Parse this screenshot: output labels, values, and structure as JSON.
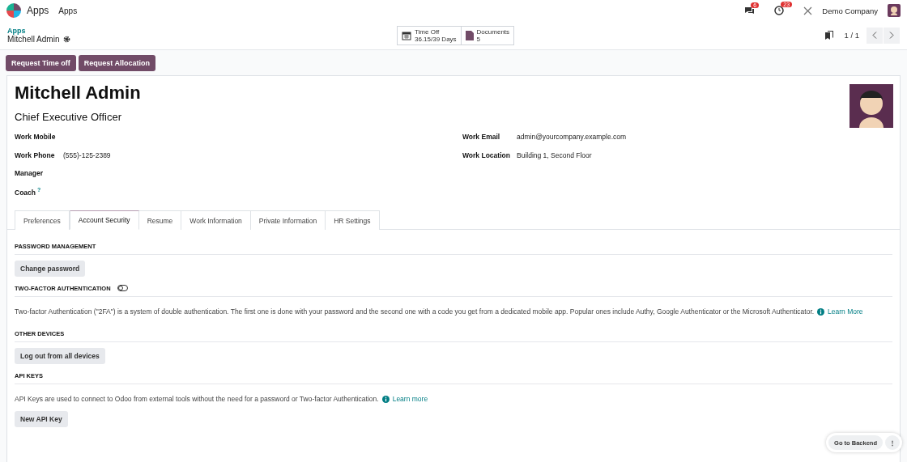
{
  "navbar": {
    "brand": "Apps",
    "menu": [
      "Apps"
    ],
    "messages_count": "6",
    "activities_count": "23",
    "company": "Demo Company"
  },
  "control_panel": {
    "breadcrumb": "Apps",
    "record": "Mitchell Admin",
    "stats": [
      {
        "kind": "calendar",
        "label": "Time Off",
        "value": "36.15/39 Days"
      },
      {
        "kind": "document",
        "label": "Documents",
        "value": "5"
      }
    ],
    "pager": "1 / 1"
  },
  "actions": [
    "Request Time off",
    "Request Allocation"
  ],
  "employee": {
    "name": "Mitchell Admin",
    "job_title": "Chief Executive Officer",
    "left_fields": [
      {
        "label": "Work Mobile"
      },
      {
        "label": "Work Phone",
        "value": "(555)-125-2389"
      },
      {
        "label": "Manager"
      },
      {
        "label": "Coach",
        "help": "?"
      }
    ],
    "right_fields": [
      {
        "label": "Work Email",
        "value": "admin@yourcompany.example.com"
      },
      {
        "label": "Work Location",
        "value": "Building 1, Second Floor"
      }
    ]
  },
  "tabs": [
    {
      "label": "Preferences",
      "selected": false
    },
    {
      "label": "Account Security",
      "selected": true
    },
    {
      "label": "Resume",
      "selected": false
    },
    {
      "label": "Work Information",
      "selected": false
    },
    {
      "label": "Private Information",
      "selected": false
    },
    {
      "label": "HR Settings",
      "selected": false
    }
  ],
  "sections": [
    {
      "title": "PASSWORD MANAGEMENT",
      "button": "Change password"
    },
    {
      "title": "TWO-FACTOR AUTHENTICATION",
      "toggle": {
        "on": false
      },
      "text": "Two-factor Authentication (\"2FA\") is a system of double authentication. The first one is done with your password and the second one with a code you get from a dedicated mobile app. Popular ones include Authy, Google Authenticator or the Microsoft Authenticator.",
      "link": "Learn More"
    },
    {
      "title": "OTHER DEVICES",
      "button": "Log out from all devices"
    },
    {
      "title": "API KEYS",
      "text": "API Keys are used to connect to Odoo from external tools without the need for a password or Two-factor Authentication.",
      "link": "Learn more",
      "button": "New API Key"
    }
  ],
  "floating": {
    "button": "Go to Backend",
    "more": "⋮"
  }
}
